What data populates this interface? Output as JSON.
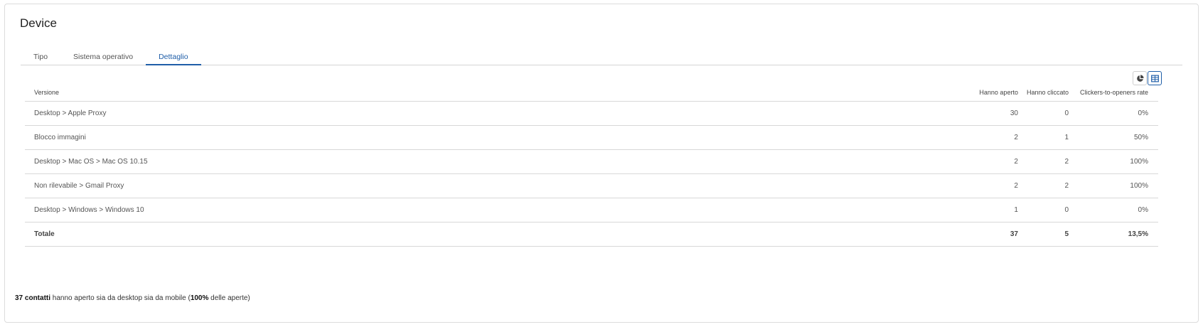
{
  "header": {
    "title": "Device"
  },
  "tabs": [
    {
      "label": "Tipo"
    },
    {
      "label": "Sistema operativo"
    },
    {
      "label": "Dettaglio",
      "active": true
    }
  ],
  "view_toggle": {
    "options": [
      "pie-chart-icon",
      "table-icon"
    ],
    "selected": "table-icon",
    "accent": "#1f5ea8"
  },
  "table": {
    "headers": [
      "Versione",
      "Hanno aperto",
      "Hanno cliccato",
      "Clickers-to-openers rate"
    ],
    "rows": [
      [
        "Desktop > Apple Proxy",
        "30",
        "0",
        "0%"
      ],
      [
        "Blocco immagini",
        "2",
        "1",
        "50%"
      ],
      [
        "Desktop > Mac OS > Mac OS 10.15",
        "2",
        "2",
        "100%"
      ],
      [
        "Non rilevabile > Gmail Proxy",
        "2",
        "2",
        "100%"
      ],
      [
        "Desktop > Windows > Windows 10",
        "1",
        "0",
        "0%"
      ]
    ],
    "total": [
      "Totale",
      "37",
      "5",
      "13,5%"
    ]
  },
  "footer": {
    "count_bold": "37 contatti",
    "text_1": " hanno aperto sia da desktop sia da mobile (",
    "percent_bold": "100%",
    "text_2": " delle aperte)"
  }
}
